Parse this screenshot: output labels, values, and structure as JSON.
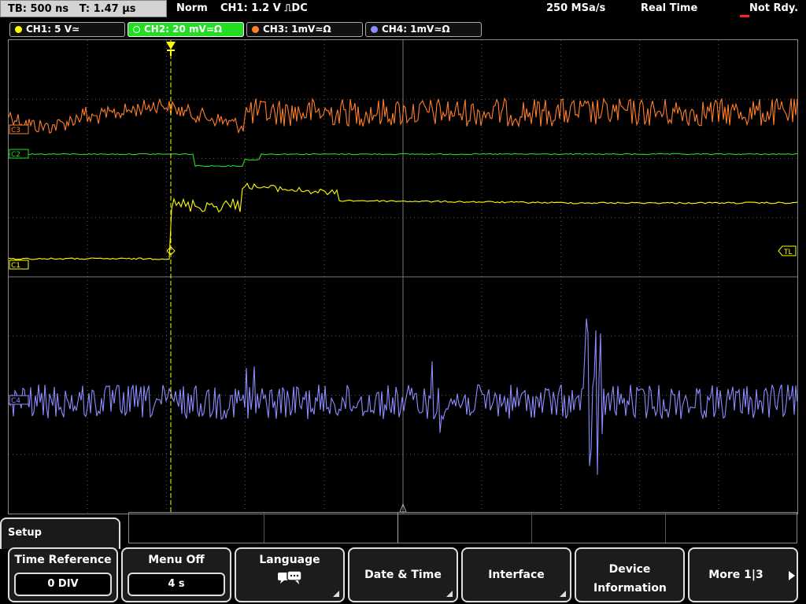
{
  "status": {
    "timebase": "TB: 500 ns",
    "trigger_time": "T: 1.47 µs",
    "trigger_mode": "Norm",
    "trigger_source": "CH1: 1.2 V ⎍DC",
    "sample_rate": "250 MSa/s",
    "acq_mode": "Real Time",
    "run_state": "Not Rdy."
  },
  "channels": [
    {
      "label": "CH1: 5 V≃",
      "color": "#ffff00",
      "marker": "C1"
    },
    {
      "label": "CH2: 20 mV≃Ω",
      "color": "#22dd22",
      "marker": "C2"
    },
    {
      "label": "CH3: 1mV≃Ω",
      "color": "#ff7f2a",
      "marker": "C3"
    },
    {
      "label": "CH4: 1mV≃Ω",
      "color": "#8c8cff",
      "marker": "C4"
    }
  ],
  "trigger_level_marker": "TL",
  "menu": {
    "title": "Setup",
    "softkeys": [
      {
        "label": "Time Reference",
        "value": "0 DIV"
      },
      {
        "label": "Menu Off",
        "value": "4 s"
      },
      {
        "label": "Language",
        "icon": "speech-bubbles-icon"
      },
      {
        "label": "Date & Time"
      },
      {
        "label": "Interface"
      },
      {
        "label": "Device Information"
      },
      {
        "label": "More 1|3"
      }
    ]
  },
  "colors": {
    "grid": "#5a5a5a",
    "trigger_line": "#ffff00"
  }
}
